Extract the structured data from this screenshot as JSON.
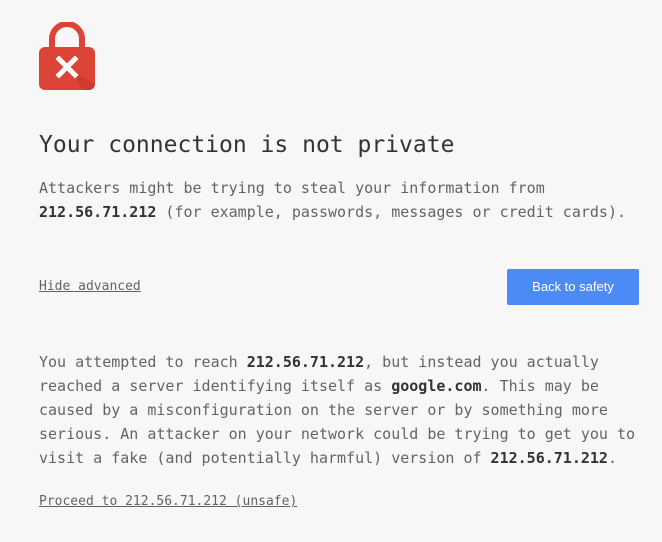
{
  "icon": {
    "name": "lock-error-icon",
    "color": "#db4437"
  },
  "title": "Your connection is not private",
  "intro": {
    "line1": "Attackers might be trying to steal your information from",
    "host": "212.56.71.212",
    "line2_rest": " (for example, passwords, messages or credit cards)."
  },
  "actions": {
    "hide_advanced_label": "Hide advanced",
    "back_to_safety_label": "Back to safety",
    "accent_color": "#4c8bf5"
  },
  "details": {
    "line1_prefix": "You attempted to reach ",
    "line1_host": "212.56.71.212",
    "line1_suffix": ", but instead you actually",
    "line2_prefix": "reached a server identifying itself as ",
    "line2_server": "google.com",
    "line2_suffix": ". This may be",
    "line3": "caused by a misconfiguration on the server or by something more",
    "line4": "serious. An attacker on your network could be trying to get you to",
    "line5_prefix": "visit a fake (and potentially harmful) version of ",
    "line5_host": "212.56.71.212",
    "line5_suffix": "."
  },
  "proceed_link_label": "Proceed to 212.56.71.212 (unsafe)"
}
